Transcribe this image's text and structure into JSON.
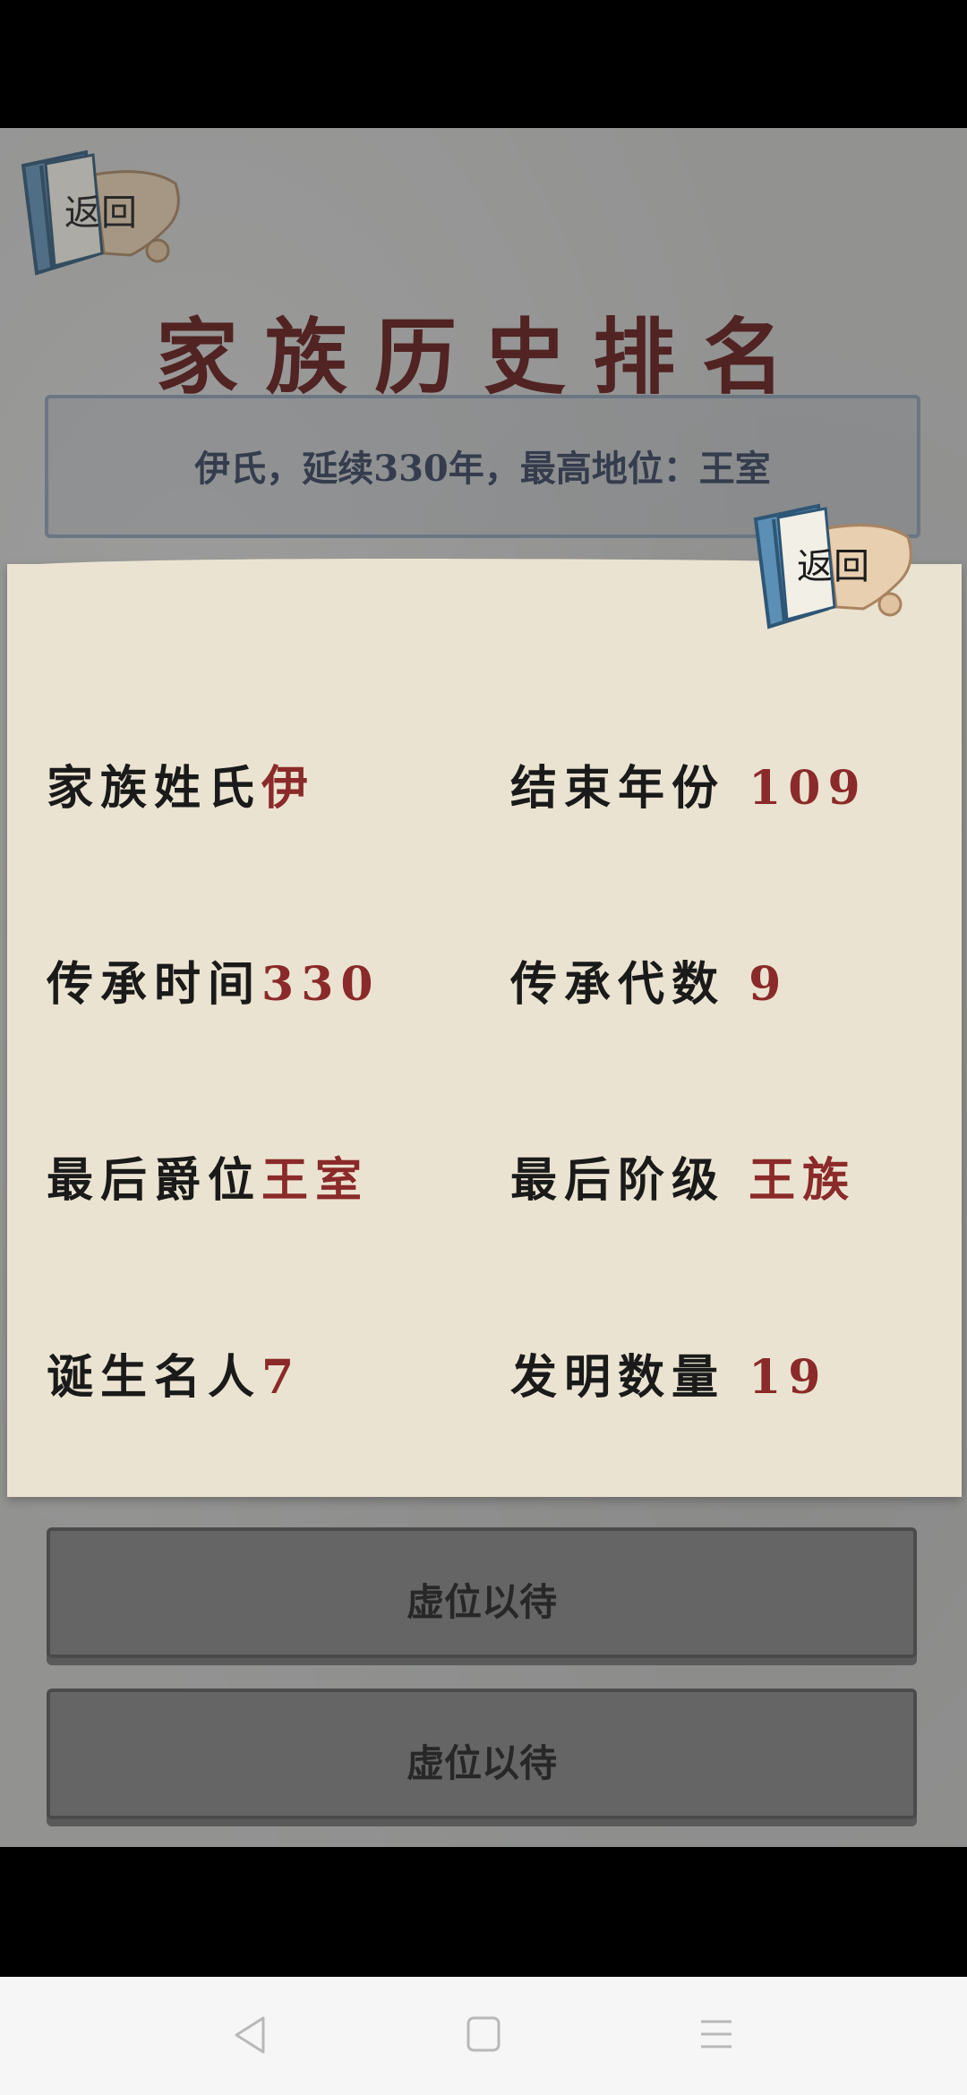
{
  "header": {
    "title": "家族历史排名",
    "back_label": "返回"
  },
  "summary": {
    "text": "伊氏，延续330年，最高地位：王室"
  },
  "slots": [
    {
      "label": "虚位以待"
    },
    {
      "label": "虚位以待"
    }
  ],
  "dialog": {
    "back_label": "返回",
    "stats": [
      {
        "label": "家族姓氏",
        "value": "伊"
      },
      {
        "label": "结束年份",
        "value": "109"
      },
      {
        "label": "传承时间",
        "value": "330"
      },
      {
        "label": "传承代数",
        "value": "9"
      },
      {
        "label": "最后爵位",
        "value": "王室"
      },
      {
        "label": "最后阶级",
        "value": "王族"
      },
      {
        "label": "诞生名人",
        "value": "7"
      },
      {
        "label": "发明数量",
        "value": "19"
      }
    ]
  },
  "nav": {
    "back_icon": "triangle-back-icon",
    "home_icon": "square-home-icon",
    "menu_icon": "lines-menu-icon"
  },
  "colors": {
    "title": "#5e1414",
    "value": "#8b2a2a",
    "summary_text": "#2f3d57",
    "dialog_bg": "#ebe3d1"
  }
}
